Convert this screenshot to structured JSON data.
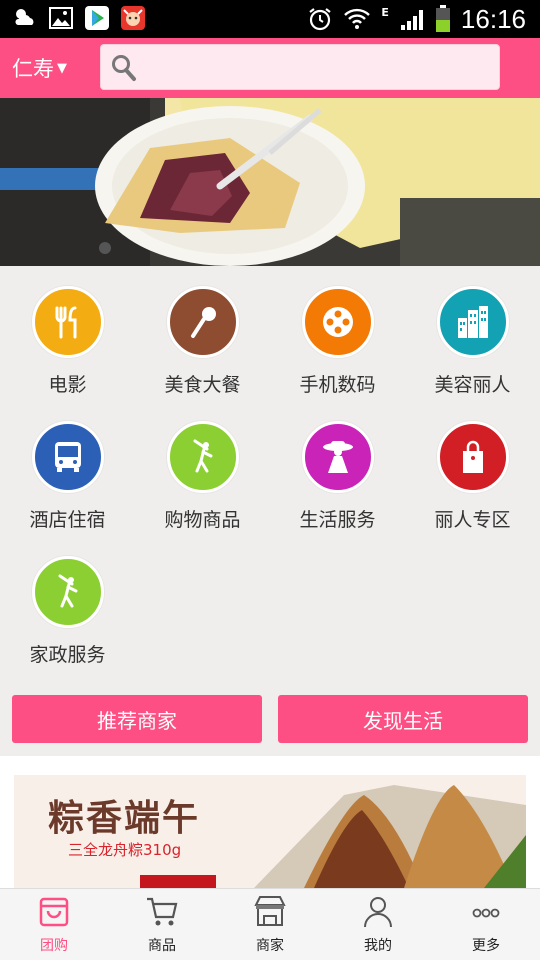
{
  "status_bar": {
    "time": "16:16",
    "network_type": "E"
  },
  "header": {
    "city": "仁寿",
    "search_placeholder": "",
    "accent_color": "#fe4f84"
  },
  "banner": {
    "slide_count": 2,
    "active_index": 1
  },
  "categories": [
    {
      "label": "电影",
      "icon": "fork-knife-icon",
      "color": "#f3ac12"
    },
    {
      "label": "美食大餐",
      "icon": "microphone-icon",
      "color": "#8e4c30"
    },
    {
      "label": "手机数码",
      "icon": "film-reel-icon",
      "color": "#f37a05"
    },
    {
      "label": "美容丽人",
      "icon": "buildings-icon",
      "color": "#13a2b3"
    },
    {
      "label": "酒店住宿",
      "icon": "bus-icon",
      "color": "#2c5fb6"
    },
    {
      "label": "购物商品",
      "icon": "golfer-icon",
      "color": "#8ccf33"
    },
    {
      "label": "生活服务",
      "icon": "lady-hat-icon",
      "color": "#c923b8"
    },
    {
      "label": "丽人专区",
      "icon": "shopping-bag-icon",
      "color": "#d11f25"
    },
    {
      "label": "家政服务",
      "icon": "golfer-icon",
      "color": "#8ccf33"
    }
  ],
  "actions": {
    "recommend_label": "推荐商家",
    "discover_label": "发现生活"
  },
  "promo": {
    "title": "粽香端午",
    "subtitle": "三全龙舟粽310g"
  },
  "bottom_nav": [
    {
      "label": "团购",
      "icon": "bag-icon",
      "active": true
    },
    {
      "label": "商品",
      "icon": "cart-icon",
      "active": false
    },
    {
      "label": "商家",
      "icon": "store-icon",
      "active": false
    },
    {
      "label": "我的",
      "icon": "person-icon",
      "active": false
    },
    {
      "label": "更多",
      "icon": "more-icon",
      "active": false
    }
  ]
}
